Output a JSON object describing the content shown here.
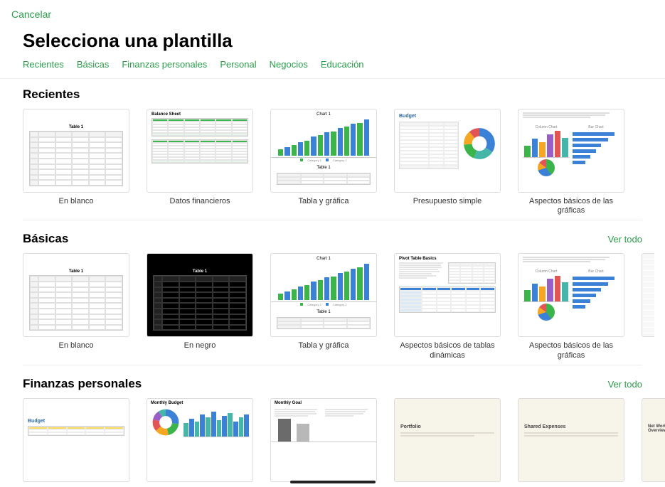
{
  "topbar": {
    "cancel": "Cancelar"
  },
  "title": "Selecciona una plantilla",
  "tabs": {
    "recent": "Recientes",
    "basic": "Básicas",
    "personal_finance": "Finanzas personales",
    "personal": "Personal",
    "business": "Negocios",
    "education": "Educación"
  },
  "see_all": "Ver todo",
  "sections": {
    "recent": {
      "title": "Recientes",
      "items": {
        "blank": "En blanco",
        "financial": "Datos financieros",
        "table_chart": "Tabla y gráfica",
        "simple_budget": "Presupuesto simple",
        "chart_basics": "Aspectos básicos de las gráficas"
      }
    },
    "basic": {
      "title": "Básicas",
      "items": {
        "blank": "En blanco",
        "black": "En negro",
        "table_chart": "Tabla y gráfica",
        "pivot_basics": "Aspectos básicos de tablas dinámicas",
        "chart_basics": "Aspectos básicos de las gráficas"
      }
    },
    "pf": {
      "title": "Finanzas personales",
      "items": {
        "budget": "Budget",
        "monthly_budget": "Monthly Budget",
        "monthly_goal": "Monthly Goal",
        "portfolio": "Portfolio",
        "shared_expenses": "Shared Expenses",
        "net_worth": "Net Worth: Overview"
      }
    }
  },
  "thumb_text": {
    "sheet_title": "Table 1",
    "balance_sheet": "Balance Sheet",
    "chart_title": "Chart 1",
    "budget": "Budget",
    "pivot": "Pivot Table Basics",
    "column_chart": "Column Chart",
    "bar_chart": "Bar Chart"
  },
  "chart_data": {
    "table_chart_bars": {
      "type": "bar",
      "series": [
        {
          "name": "Category 1",
          "color": "#3bb54a",
          "values": [
            10,
            18,
            24,
            32,
            38,
            46,
            52
          ]
        },
        {
          "name": "Category 2",
          "color": "#3b82d6",
          "values": [
            14,
            22,
            30,
            36,
            44,
            50,
            58
          ]
        }
      ]
    },
    "simple_budget_donut": {
      "type": "pie",
      "slices": [
        {
          "color": "#3b82d6",
          "value": 35
        },
        {
          "color": "#45b6a8",
          "value": 22
        },
        {
          "color": "#3bb54a",
          "value": 18
        },
        {
          "color": "#f5a623",
          "value": 15
        },
        {
          "color": "#e25555",
          "value": 10
        }
      ]
    },
    "chart_basics_column": {
      "type": "bar",
      "values": [
        {
          "v": 20,
          "c": "#3bb54a"
        },
        {
          "v": 32,
          "c": "#3b82d6"
        },
        {
          "v": 26,
          "c": "#f5a623"
        },
        {
          "v": 40,
          "c": "#9a5fc7"
        },
        {
          "v": 46,
          "c": "#e25555"
        },
        {
          "v": 34,
          "c": "#45b6a8"
        }
      ]
    },
    "chart_basics_hbar": {
      "type": "bar_horizontal",
      "values": [
        90,
        75,
        60,
        50,
        38,
        28
      ]
    },
    "monthly_budget_bars": {
      "type": "bar",
      "values": [
        18,
        24,
        20,
        30,
        26,
        34,
        22,
        28,
        32,
        20,
        26,
        30
      ]
    },
    "monthly_goal_bars": {
      "type": "bar",
      "values": [
        {
          "v": 38,
          "c": "#6b6b6b"
        },
        {
          "v": 30,
          "c": "#b8b8b8"
        }
      ]
    }
  }
}
